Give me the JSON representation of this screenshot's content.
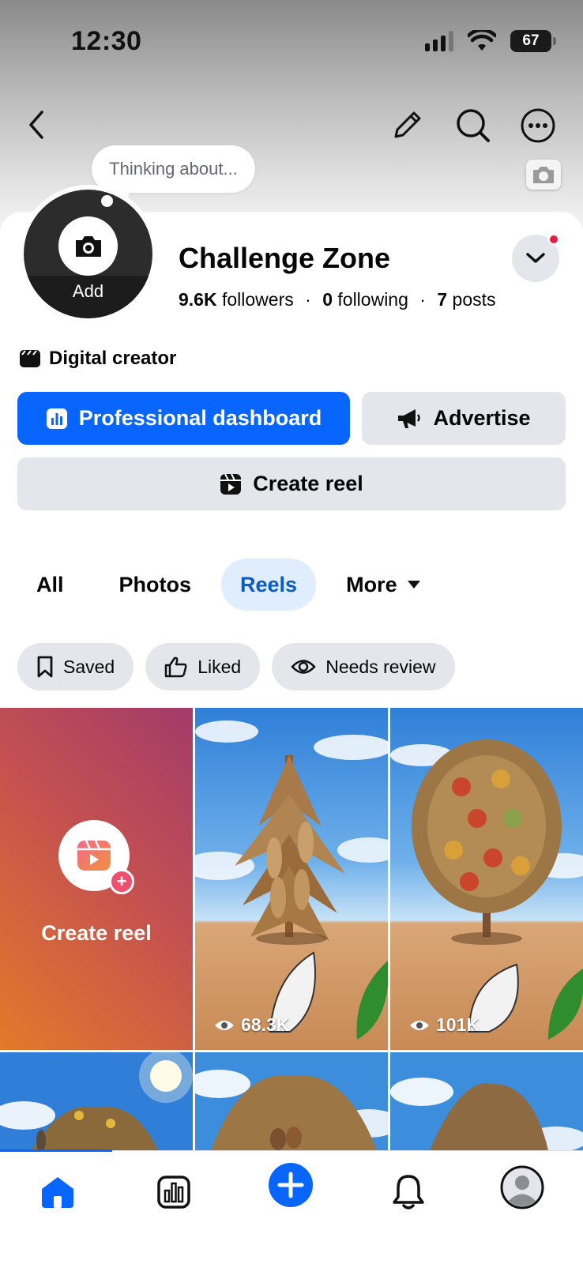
{
  "status_bar": {
    "time": "12:30",
    "battery": "67"
  },
  "header": {
    "back_icon": "chevron-left-icon",
    "edit_icon": "pencil-icon",
    "search_icon": "search-icon",
    "more_icon": "more-horizontal-icon",
    "cover_camera_icon": "camera-icon"
  },
  "profile": {
    "thought_placeholder": "Thinking about...",
    "avatar_add_label": "Add",
    "name": "Challenge Zone",
    "followers_count": "9.6K",
    "followers_label": "followers",
    "following_count": "0",
    "following_label": "following",
    "posts_count": "7",
    "posts_label": "posts",
    "category": "Digital creator",
    "has_notification": true
  },
  "actions": {
    "dashboard_label": "Professional dashboard",
    "advertise_label": "Advertise",
    "create_reel_label": "Create reel"
  },
  "tabs": [
    {
      "label": "All",
      "active": false
    },
    {
      "label": "Photos",
      "active": false
    },
    {
      "label": "Reels",
      "active": true
    },
    {
      "label": "More",
      "active": false
    }
  ],
  "filters": [
    {
      "label": "Saved",
      "icon": "bookmark-icon"
    },
    {
      "label": "Liked",
      "icon": "thumbs-up-icon"
    },
    {
      "label": "Needs review",
      "icon": "eye-icon"
    }
  ],
  "grid": {
    "create_reel_label": "Create reel",
    "reels": [
      {
        "views": "68.3K",
        "subject": "corn plant"
      },
      {
        "views": "101K",
        "subject": "pepper plant"
      },
      {
        "views": "",
        "subject": "gourd vine"
      },
      {
        "views": "",
        "subject": "papaya tree"
      },
      {
        "views": "",
        "subject": "dry plant"
      }
    ]
  },
  "bottom_nav": [
    {
      "name": "home",
      "icon": "home-icon",
      "active": true
    },
    {
      "name": "dashboard",
      "icon": "bar-chart-icon",
      "active": false
    },
    {
      "name": "create",
      "icon": "plus-icon",
      "active": false
    },
    {
      "name": "notifications",
      "icon": "bell-icon",
      "active": false
    },
    {
      "name": "profile",
      "icon": "avatar-icon",
      "active": false
    }
  ],
  "colors": {
    "brand_blue": "#0866ff",
    "active_tab_bg": "#dfedfc",
    "active_tab_text": "#0a5bc4",
    "button_gray": "#e4e6eb",
    "notification_red": "#e41e3f"
  }
}
